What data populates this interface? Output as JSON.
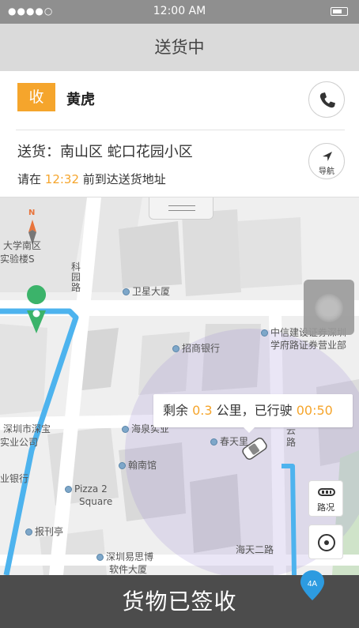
{
  "status_bar": {
    "signal": "●●●●○",
    "time": "12:00 AM"
  },
  "header": {
    "title": "送货中"
  },
  "recipient": {
    "badge": "收",
    "name": "黄虎"
  },
  "delivery": {
    "address": "送货：南山区 蛇口花园小区",
    "deadline_prefix": "请在 ",
    "deadline_time": "12:32",
    "deadline_suffix": " 前到达送货地址",
    "nav_label": "导航"
  },
  "map": {
    "compass_label": "N",
    "labels": {
      "university": "大学南区",
      "lab_building": "实验楼S",
      "road_kejiyuan": "科\n园\n路",
      "weixing": "卫星大厦",
      "zhongxin": "中信建设证券深圳",
      "xuefu": "学府路证券营业部",
      "zhaoshang": "招商银行",
      "shenzhen_city": "深圳市深宝",
      "industry_co": "实业公司",
      "haixin": "海泉实业",
      "chuntian": "春天里",
      "yun_road": "云\n路",
      "hannan": "翰南馆",
      "bank_left": "业银行",
      "pizza": "Pizza 2",
      "pizza2": "Square",
      "newsstand": "报刊亭",
      "shenzhen_yisi": "深圳易思博",
      "software": "软件大厦",
      "haitian2": "海天二路"
    },
    "progress": {
      "prefix": "剩余 ",
      "distance": "0.3",
      "middle": " 公里，已行驶 ",
      "elapsed": "00:50"
    },
    "traffic_label": "路况",
    "route_badge": "4A"
  },
  "action": {
    "confirm_label": "货物已签收"
  },
  "colors": {
    "accent": "#f5a52c",
    "route": "#4db3ee",
    "dark_bar": "#4c4c4c"
  }
}
